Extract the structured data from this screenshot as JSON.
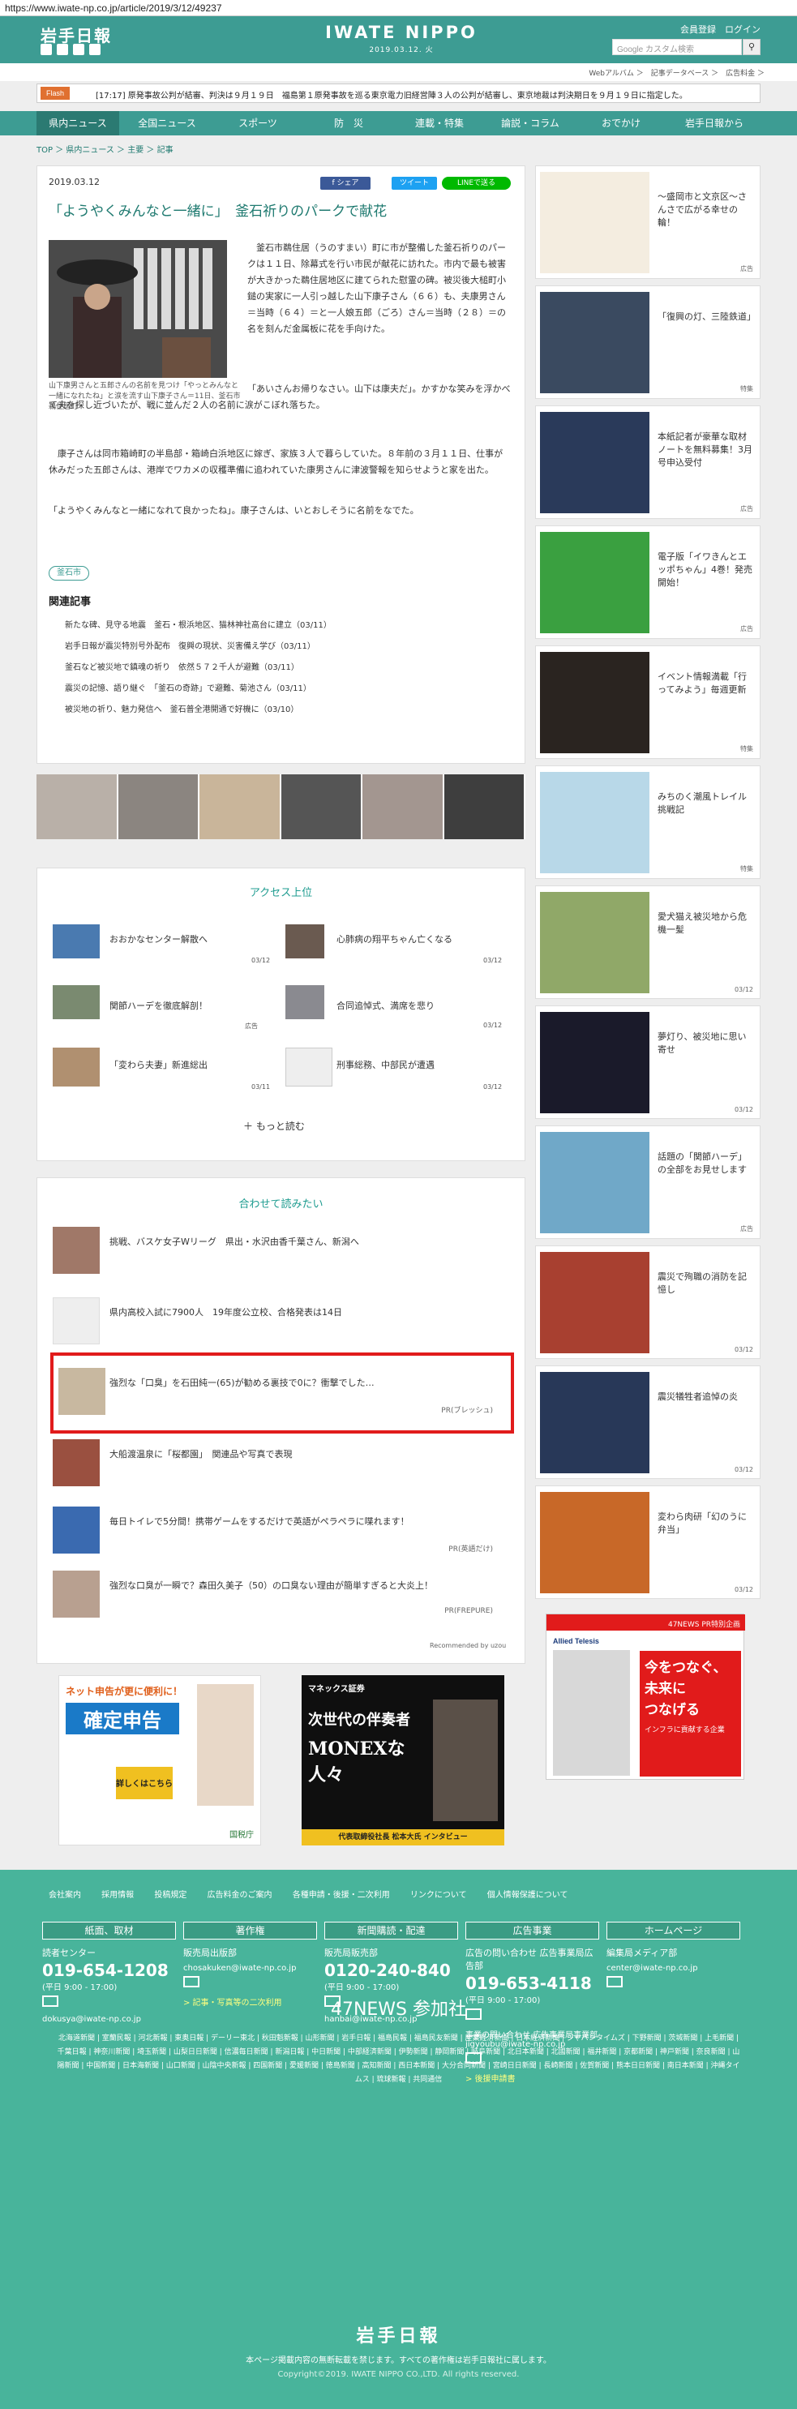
{
  "url": "https://www.iwate-np.co.jp/article/2019/3/12/49237",
  "header": {
    "logo": "岩手日報",
    "brand": "IWATE NIPPO",
    "date": "2019.03.12. 火",
    "account": "会員登録　ログイン",
    "search_placeholder": "Google カスタム検索",
    "subnav": "Webアルバム ＞　記事データベース ＞　広告料金 ＞"
  },
  "flash": {
    "tag": "Flash",
    "text": "[17:17] 原発事故公判が結審、判決は９月１９日　福島第１原発事故を巡る東京電力旧経営陣３人の公判が結審し、東京地裁は判決期日を９月１９日に指定した。"
  },
  "nav": [
    "県内ニュース",
    "全国ニュース",
    "スポーツ",
    "防　災",
    "連載・特集",
    "論説・コラム",
    "おでかけ",
    "岩手日報から"
  ],
  "breadcrumb": "TOP ＞ 県内ニュース ＞ 主要 ＞ 記事",
  "article": {
    "date": "2019.03.12",
    "share": [
      "f シェア",
      "ツイート",
      "LINEで送る"
    ],
    "title": "「ようやくみんなと一緒に」　釜石祈りのパークで献花",
    "caption": "山下康男さんと五郎さんの名前を見つけ「やっとみんなと一緒になれたね」と涙を流す山下康子さん＝11日、釜石市鵜住居町",
    "p1": "　釜石市鵜住居（うのすまい）町に市が整備した釜石祈りのパークは１１日、除幕式を行い市民が献花に訪れた。市内で最も被害が大きかった鵜住居地区に建てられた慰霊の碑。被災後大槌町小鎚の実家に一人引っ越した山下康子さん（６６）も、夫康男さん＝当時（６４）＝と一人娘五郎（ごろ）さん＝当時（２８）＝の名を刻んだ金属板に花を手向けた。",
    "p2": "「あいさんお帰りなさい。山下は康夫だ」。かすかな笑みを浮かべて夫を探し近づいたが、戦に並んだ２人の名前に涙がこぼれ落ちた。",
    "p3": "　康子さんは同市箱崎町の半島部・箱崎白浜地区に嫁ぎ、家族３人で暮らしていた。８年前の３月１１日、仕事が休みだった五郎さんは、港岸でワカメの収穫準備に追われていた康男さんに津波警報を知らせようと家を出た。",
    "p4": "「ようやくみんなと一緒になれて良かったね」。康子さんは、いとおしそうに名前をなでた。",
    "tag": "釜石市",
    "related_heading": "関連記事",
    "related": [
      "新たな碑、見守る地震　釜石・根浜地区、猫林神社高台に建立（03/11）",
      "岩手日報が震災特別号外配布　復興の現状、災害備え学び（03/11）",
      "釜石など被災地で鎮魂の祈り　依然５７２千人が避難（03/11）",
      "震災の記憶、語り継ぐ　「釜石の奇跡」で避難、菊池さん（03/11）",
      "被災地の祈り、魅力発信へ　釜石普全港開通で好機に（03/10）"
    ]
  },
  "access": {
    "heading": "アクセス上位",
    "items": [
      {
        "title": "おおかなセンター解散へ",
        "date": "03/12"
      },
      {
        "title": "心肺病の翔平ちゃん亡くなる",
        "date": "03/12"
      },
      {
        "title": "関節ハーデを徹底解剖！",
        "date": "広告"
      },
      {
        "title": "合同追悼式、満席を悲り",
        "date": "03/12"
      },
      {
        "title": "「変わら夫妻」新進総出",
        "date": "03/11"
      },
      {
        "title": "刑事総務、中部民が遭遇",
        "date": "03/12"
      }
    ],
    "more": "もっと読む"
  },
  "recommend": {
    "heading": "合わせて読みたい",
    "items": [
      {
        "title": "挑戦、バスケ女子Wリーグ　県出・水沢由香千葉さん、新潟へ",
        "src": ""
      },
      {
        "title": "県内高校入試に7900人　19年度公立校、合格発表は14日",
        "src": ""
      },
      {
        "title": "強烈な「口臭」を石田純一(65)が勧める裏技で0に？衝撃でした…",
        "src": "PR(ブレッシュ)"
      },
      {
        "title": "大船渡温泉に「桜都園」　関連品や写真で表現",
        "src": ""
      },
      {
        "title": "毎日トイレで5分間！携帯ゲームをするだけで英語がペラペラに喋れます！",
        "src": "PR(英語だけ)"
      },
      {
        "title": "強烈な口臭が一瞬で？森田久美子（50）の口臭ない理由が簡単すぎると大炎上！",
        "src": "PR(FREPURE)"
      }
    ],
    "credit": "Recommended by uzou"
  },
  "sidebar": [
    {
      "text": "〜盛岡市と文京区〜さんさで広がる幸せの輪！",
      "label": "広告"
    },
    {
      "text": "「復興の灯、三陸鉄道」",
      "label": "特集"
    },
    {
      "text": "本紙記者が豪華な取材ノートを無料募集！3月号申込受付",
      "label": "広告"
    },
    {
      "text": "電子版「イワきんとエッポちゃん」4巻！発売開始！",
      "label": "広告"
    },
    {
      "text": "イベント情報満載「行ってみよう」毎週更新",
      "label": "特集"
    },
    {
      "text": "みちのく潮風トレイル挑戦記",
      "label": "特集"
    },
    {
      "text": "愛犬猫え被災地から危機一髪",
      "label": "03/12"
    },
    {
      "text": "夢灯り、被災地に思い寄せ",
      "label": "03/12"
    },
    {
      "text": "話題の「関節ハーデ」の全部をお見せします",
      "label": "広告"
    },
    {
      "text": "震災で殉職の消防を記憶し",
      "label": "03/12"
    },
    {
      "text": "震災犠牲者追悼の炎",
      "label": "03/12"
    },
    {
      "text": "変わら肉研「幻のうに弁当」",
      "label": "03/12"
    }
  ],
  "wide_ad": {
    "badge": "47NEWS PR特別企画",
    "brand": "Allied Telesis",
    "l1": "今をつなぐ、",
    "l2": "未来に",
    "l3": "つなげる",
    "l4": "インフラに貢献する企業"
  },
  "bottom_ads": [
    {
      "t1": "ネット申告が更に便利に！",
      "t2": "確定申告",
      "t3": "詳しくはこちら",
      "t4": "国税庁"
    },
    {
      "t1": "マネックス証券",
      "t2": "次世代の伴奏者",
      "t3": "MONEXな人々",
      "t4": "代表取締役社長 松本大氏 インタビュー"
    }
  ],
  "footer": {
    "links": "会社案内 採用情報 投稿規定 広告料金のご案内 各種申請・後援・二次利用 リンクについて 個人情報保護について",
    "cols": [
      {
        "h": "紙面、取材",
        "t": "読者センター",
        "p": "019-654-1208",
        "s": "(平日 9:00 - 17:00)",
        "m": "dokusya@iwate-np.co.jp",
        "y": ""
      },
      {
        "h": "著作権",
        "t": "販売局出版部",
        "p": "",
        "s": "",
        "m": "chosakuken@iwate-np.co.jp",
        "y": "> 記事・写真等の二次利用"
      },
      {
        "h": "新聞購読・配達",
        "t": "販売局販売部",
        "p": "0120-240-840",
        "s": "(平日 9:00 - 17:00)",
        "m": "hanbai@iwate-np.co.jp",
        "y": ""
      },
      {
        "h": "広告事業",
        "t": "広告の問い合わせ 広告事業局広告部",
        "p": "019-653-4118",
        "s": "(平日 9:00 - 17:00)",
        "m": "事業の問い合わせ 広告事業局事業部 jigyoubu@iwate-np.co.jp",
        "y": "> 後援申請書"
      },
      {
        "h": "ホームページ",
        "t": "編集局メディア部",
        "p": "",
        "s": "",
        "m": "center@iwate-np.co.jp",
        "y": ""
      }
    ],
    "n47": "47NEWS 参加社",
    "papers": "北海道新聞 | 室蘭民報 | 河北新報 | 東奥日報 | デーリー東北 | 秋田魁新報 | 山形新聞 | 岩手日報 | 福島民報 | 福島民友新聞 | 産業経済新聞 | 日本経済新聞 | ジャパンタイムズ | 下野新聞 | 茨城新聞 | 上毛新聞 | 千葉日報 | 神奈川新聞 | 埼玉新聞 | 山梨日日新聞 | 信濃毎日新聞 | 新潟日報 | 中日新聞 | 中部経済新聞 | 伊勢新聞 | 静岡新聞 | 岐阜新聞 | 北日本新聞 | 北國新聞 | 福井新聞 | 京都新聞 | 神戸新聞 | 奈良新聞 | 山陽新聞 | 中国新聞 | 日本海新聞 | 山口新聞 | 山陰中央新報 | 四国新聞 | 愛媛新聞 | 徳島新聞 | 高知新聞 | 西日本新聞 | 大分合同新聞 | 宮崎日日新聞 | 長崎新聞 | 佐賀新聞 | 熊本日日新聞 | 南日本新聞 | 沖縄タイムス | 琉球新報 | 共同通信",
    "logo": "岩手日報",
    "notice": "本ページ掲載内容の無断転載を禁じます。すべての著作権は岩手日報社に属します。",
    "copy": "Copyright©2019. IWATE NIPPO CO.,LTD. All rights reserved."
  },
  "colors": {
    "teal": "#3d9c93",
    "red": "#e11b1b",
    "footer": "#48b49b"
  }
}
